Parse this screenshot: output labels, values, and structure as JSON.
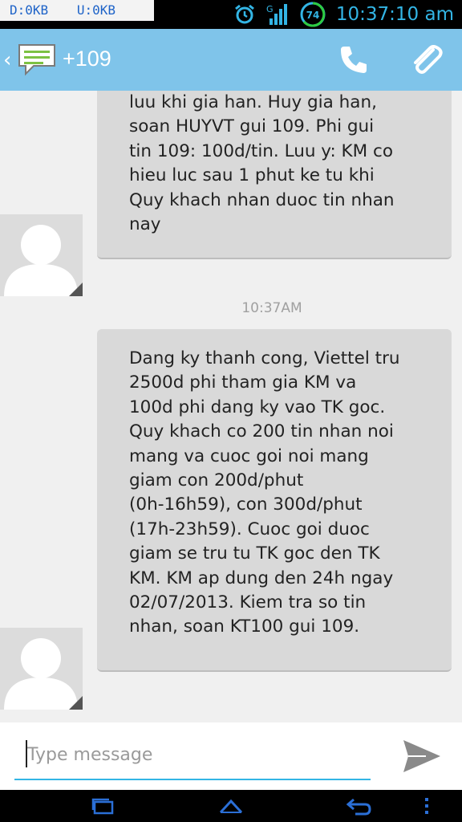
{
  "status_bar": {
    "download": "D:0KB",
    "upload": "U:0KB",
    "battery_level": "74",
    "time": "10:37:10 am"
  },
  "action_bar": {
    "contact": "+109",
    "icons": [
      "back-chevron-icon",
      "message-icon",
      "phone-icon",
      "attach-icon"
    ]
  },
  "conversation": {
    "messages": [
      {
        "text": "luu khi gia han. Huy gia han,\nsoan HUYVT gui 109. Phi gui\ntin 109: 100d/tin. Luu y: KM co\nhieu luc sau 1 phut ke tu khi\nQuy khach nhan duoc tin nhan\nnay"
      },
      {
        "text": "Dang ky thanh cong, Viettel tru\n2500d phi tham gia KM va\n100d phi dang ky vao TK goc.\nQuy khach co 200 tin nhan noi\nmang va cuoc goi noi mang\ngiam con 200d/phut\n(0h-16h59), con 300d/phut\n(17h-23h59). Cuoc goi duoc\ngiam se tru tu TK goc den TK\nKM. KM ap dung den 24h ngay\n02/07/2013. Kiem tra so tin\nnhan, soan KT100 gui 109."
      }
    ],
    "timestamp": "10:37AM"
  },
  "compose": {
    "placeholder": "Type message",
    "value": ""
  },
  "colors": {
    "accent": "#33b5e5",
    "action_bar": "#7fc4ea",
    "bubble": "#d9d9d9",
    "background": "#f0f0f0"
  }
}
